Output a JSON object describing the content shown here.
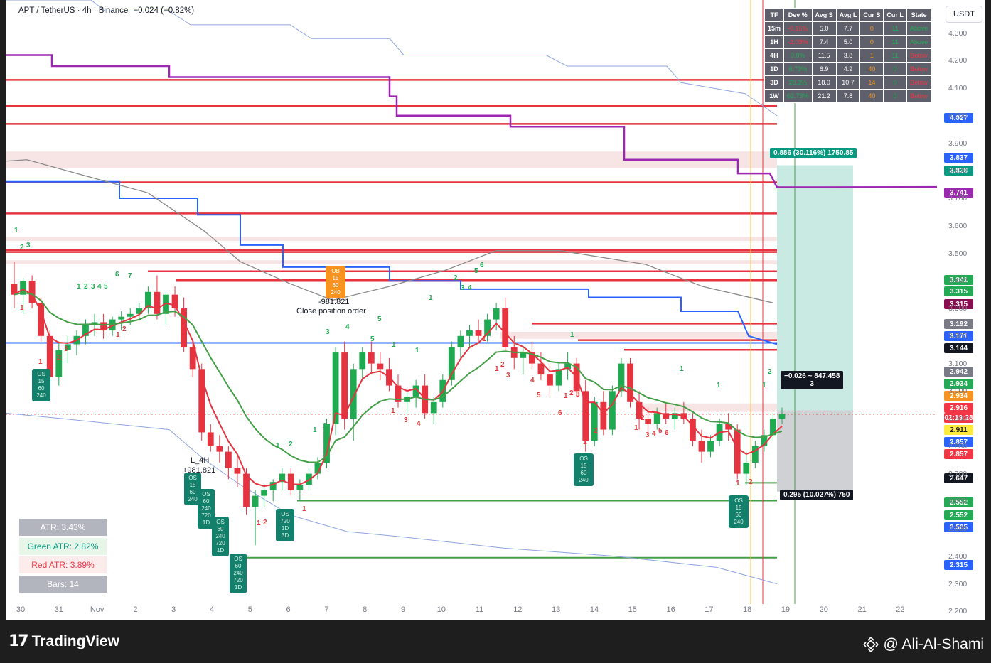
{
  "header": {
    "symbol": "APT / TetherUS · 4h · Binance",
    "change": "−0.024 (−0.82%)"
  },
  "currency_button": "USDT",
  "timeframe_table": {
    "headers": [
      "TF",
      "Dev %",
      "Avg S",
      "Avg L",
      "Cur S",
      "Cur L",
      "State"
    ],
    "rows": [
      [
        "15m",
        "-0.16%",
        "5.0",
        "7.7",
        "0",
        "11",
        "Above"
      ],
      [
        "1H",
        "-2.03%",
        "7.4",
        "5.0",
        "0",
        "11",
        "Above"
      ],
      [
        "4H",
        "0.0%",
        "11.5",
        "3.8",
        "1",
        "11",
        "Below"
      ],
      [
        "1D",
        "6.73%",
        "6.9",
        "4.9",
        "40",
        "0",
        "Below"
      ],
      [
        "3D",
        "28.3%",
        "18.0",
        "10.7",
        "14",
        "0",
        "Below"
      ],
      [
        "1W",
        "62.73%",
        "21.2",
        "7.8",
        "40",
        "0",
        "Below"
      ]
    ],
    "dev_colors": [
      "#f23645",
      "#f23645",
      "#22ab54",
      "#22ab54",
      "#22ab54",
      "#22ab54"
    ],
    "state_colors": [
      "#22ab54",
      "#22ab54",
      "#f23645",
      "#f23645",
      "#f23645",
      "#f23645"
    ],
    "cur_s_color": "#f7931e"
  },
  "stats": {
    "atr": "ATR: 3.43%",
    "green_atr": "Green ATR: 2.82%",
    "red_atr": "Red ATR: 3.89%",
    "bars": "Bars: 14"
  },
  "trade": {
    "target_label": "0.886 (30.116%) 1750.85",
    "stop_label": "0.295 (10.027%) 750",
    "entry_label": "−0.026 ~ 847.458",
    "entry_sub": "3"
  },
  "annotations": {
    "close_position": "Close position order",
    "close_value": "-981.821",
    "long_label": "L_4H",
    "long_value": "+981.821"
  },
  "footer": {
    "brand": "TradingView",
    "author": "@ Ali-Al-Shami"
  },
  "chart_data": {
    "type": "candlestick",
    "title": "APT / TetherUS · 4h · Binance",
    "y_axis_ticks": [
      "4.300",
      "4.200",
      "4.100",
      "4.000",
      "3.900",
      "3.800",
      "3.700",
      "3.600",
      "3.500",
      "3.400",
      "3.300",
      "3.200",
      "3.100",
      "3.000",
      "2.900",
      "2.800",
      "2.700",
      "2.600",
      "2.500",
      "2.400",
      "2.300",
      "2.200"
    ],
    "ylim": [
      2.17,
      4.42
    ],
    "x_axis_ticks": [
      "30",
      "31",
      "Nov",
      "2",
      "3",
      "4",
      "5",
      "6",
      "7",
      "8",
      "9",
      "10",
      "11",
      "12",
      "13",
      "14",
      "15",
      "16",
      "17",
      "18",
      "19",
      "20",
      "21",
      "22"
    ],
    "price_labels": [
      {
        "value": "4.027",
        "color": "#2962ff"
      },
      {
        "value": "3.837",
        "color": "#2962ff"
      },
      {
        "value": "3.828",
        "color": "#089981"
      },
      {
        "value": "3.741",
        "color": "#9c27b0"
      },
      {
        "value": "3.341",
        "color": "#22ab54"
      },
      {
        "value": "3.315",
        "color": "#22ab54"
      },
      {
        "value": "3.315",
        "color": "#880e4f"
      },
      {
        "value": "3.192",
        "color": "#787b86"
      },
      {
        "value": "3.171",
        "color": "#2962ff"
      },
      {
        "value": "3.144",
        "color": "#131722"
      },
      {
        "value": "2.942",
        "color": "#787b86"
      },
      {
        "value": "2.934",
        "color": "#22ab54"
      },
      {
        "value": "2.934",
        "color": "#f7931e"
      },
      {
        "value": "2.916",
        "color": "#f23645"
      },
      {
        "value": "02:19:28",
        "color": "#f23645"
      },
      {
        "value": "2.911",
        "color": "#ffeb3b"
      },
      {
        "value": "2.857",
        "color": "#2962ff"
      },
      {
        "value": "2.857",
        "color": "#f23645"
      },
      {
        "value": "2.647",
        "color": "#131722"
      },
      {
        "value": "2.552",
        "color": "#22ab54"
      },
      {
        "value": "2.552",
        "color": "#22ab54"
      },
      {
        "value": "2.505",
        "color": "#2962ff"
      },
      {
        "value": "2.315",
        "color": "#2962ff"
      }
    ],
    "resistance_levels": [
      4.13,
      4.035,
      3.97,
      3.758,
      3.645,
      3.512,
      3.505,
      3.435,
      3.405,
      3.4,
      3.245,
      3.185,
      3.15
    ],
    "support_levels": [
      2.603,
      2.395
    ],
    "horizontal_blue": 3.175,
    "candles": [
      [
        3.39,
        3.47,
        3.3,
        3.35
      ],
      [
        3.35,
        3.41,
        3.28,
        3.4
      ],
      [
        3.4,
        3.42,
        3.3,
        3.32
      ],
      [
        3.32,
        3.34,
        3.18,
        3.2
      ],
      [
        3.2,
        3.22,
        3.02,
        3.05
      ],
      [
        3.05,
        3.18,
        3.02,
        3.15
      ],
      [
        3.15,
        3.2,
        3.1,
        3.17
      ],
      [
        3.17,
        3.22,
        3.13,
        3.2
      ],
      [
        3.2,
        3.26,
        3.17,
        3.24
      ],
      [
        3.24,
        3.28,
        3.2,
        3.25
      ],
      [
        3.25,
        3.28,
        3.19,
        3.22
      ],
      [
        3.22,
        3.27,
        3.2,
        3.26
      ],
      [
        3.26,
        3.29,
        3.22,
        3.27
      ],
      [
        3.27,
        3.3,
        3.24,
        3.28
      ],
      [
        3.28,
        3.32,
        3.26,
        3.3
      ],
      [
        3.3,
        3.38,
        3.28,
        3.36
      ],
      [
        3.36,
        3.42,
        3.26,
        3.28
      ],
      [
        3.28,
        3.36,
        3.24,
        3.35
      ],
      [
        3.35,
        3.38,
        3.27,
        3.3
      ],
      [
        3.3,
        3.34,
        3.14,
        3.16
      ],
      [
        3.16,
        3.18,
        3.05,
        3.08
      ],
      [
        3.08,
        3.1,
        2.82,
        2.85
      ],
      [
        2.85,
        2.88,
        2.78,
        2.8
      ],
      [
        2.8,
        2.84,
        2.74,
        2.78
      ],
      [
        2.78,
        2.8,
        2.68,
        2.72
      ],
      [
        2.72,
        2.76,
        2.65,
        2.7
      ],
      [
        2.7,
        2.72,
        2.55,
        2.58
      ],
      [
        2.58,
        2.64,
        2.44,
        2.62
      ],
      [
        2.62,
        2.66,
        2.58,
        2.64
      ],
      [
        2.64,
        2.68,
        2.6,
        2.67
      ],
      [
        2.67,
        2.72,
        2.64,
        2.7
      ],
      [
        2.7,
        2.72,
        2.62,
        2.64
      ],
      [
        2.64,
        2.68,
        2.6,
        2.66
      ],
      [
        2.66,
        2.72,
        2.64,
        2.7
      ],
      [
        2.7,
        2.76,
        2.68,
        2.74
      ],
      [
        2.74,
        2.9,
        2.72,
        2.88
      ],
      [
        2.88,
        3.16,
        2.84,
        3.14
      ],
      [
        3.14,
        3.18,
        2.86,
        2.9
      ],
      [
        2.9,
        3.1,
        2.82,
        3.08
      ],
      [
        3.08,
        3.16,
        3.04,
        3.14
      ],
      [
        3.14,
        3.18,
        3.06,
        3.1
      ],
      [
        3.1,
        3.14,
        3.04,
        3.08
      ],
      [
        3.08,
        3.12,
        3.0,
        3.02
      ],
      [
        3.02,
        3.06,
        2.94,
        2.96
      ],
      [
        2.96,
        3.0,
        2.92,
        2.98
      ],
      [
        2.98,
        3.04,
        2.94,
        3.02
      ],
      [
        3.02,
        3.06,
        2.9,
        2.92
      ],
      [
        2.92,
        2.98,
        2.88,
        2.96
      ],
      [
        2.96,
        3.06,
        2.94,
        3.04
      ],
      [
        3.04,
        3.18,
        3.02,
        3.16
      ],
      [
        3.16,
        3.22,
        3.12,
        3.2
      ],
      [
        3.2,
        3.24,
        3.16,
        3.22
      ],
      [
        3.22,
        3.26,
        3.18,
        3.2
      ],
      [
        3.2,
        3.28,
        3.18,
        3.26
      ],
      [
        3.26,
        3.32,
        3.22,
        3.3
      ],
      [
        3.3,
        3.34,
        3.14,
        3.16
      ],
      [
        3.16,
        3.2,
        3.08,
        3.12
      ],
      [
        3.12,
        3.16,
        3.06,
        3.14
      ],
      [
        3.14,
        3.18,
        3.08,
        3.1
      ],
      [
        3.1,
        3.14,
        3.04,
        3.06
      ],
      [
        3.06,
        3.1,
        2.98,
        3.02
      ],
      [
        3.02,
        3.1,
        3.0,
        3.08
      ],
      [
        3.08,
        3.14,
        3.04,
        3.1
      ],
      [
        3.1,
        3.12,
        2.98,
        3.0
      ],
      [
        3.0,
        3.04,
        2.78,
        2.82
      ],
      [
        2.82,
        2.98,
        2.8,
        2.96
      ],
      [
        2.96,
        3.0,
        2.84,
        2.86
      ],
      [
        2.86,
        3.02,
        2.84,
        3.0
      ],
      [
        3.0,
        3.12,
        2.98,
        3.1
      ],
      [
        3.1,
        3.12,
        2.94,
        2.96
      ],
      [
        2.96,
        3.0,
        2.86,
        2.9
      ],
      [
        2.9,
        2.94,
        2.84,
        2.88
      ],
      [
        2.88,
        2.94,
        2.86,
        2.92
      ],
      [
        2.92,
        2.96,
        2.88,
        2.9
      ],
      [
        2.9,
        2.94,
        2.86,
        2.92
      ],
      [
        2.92,
        2.96,
        2.88,
        2.9
      ],
      [
        2.9,
        2.92,
        2.8,
        2.82
      ],
      [
        2.82,
        2.86,
        2.74,
        2.78
      ],
      [
        2.78,
        2.84,
        2.76,
        2.82
      ],
      [
        2.82,
        2.9,
        2.8,
        2.88
      ],
      [
        2.88,
        2.92,
        2.82,
        2.86
      ],
      [
        2.86,
        2.88,
        2.68,
        2.7
      ],
      [
        2.7,
        2.78,
        2.66,
        2.74
      ],
      [
        2.74,
        2.82,
        2.72,
        2.8
      ],
      [
        2.8,
        2.86,
        2.78,
        2.84
      ],
      [
        2.84,
        2.92,
        2.82,
        2.9
      ],
      [
        2.9,
        2.94,
        2.88,
        2.916
      ]
    ]
  }
}
